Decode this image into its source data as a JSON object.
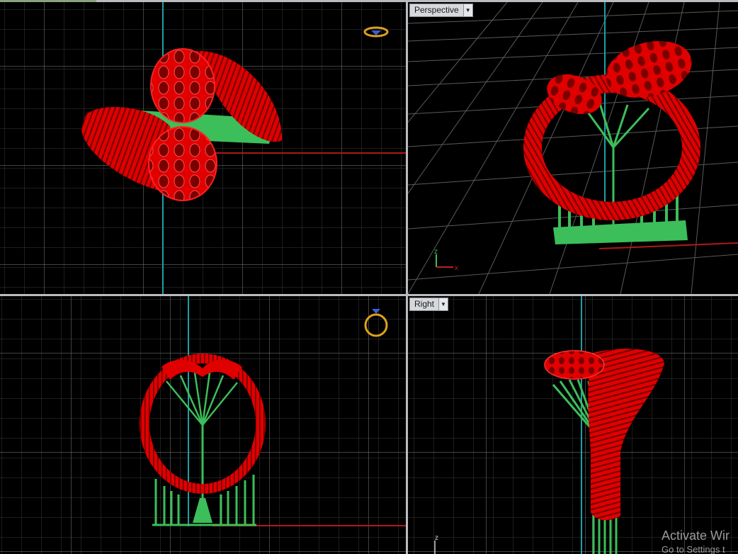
{
  "viewports": {
    "top": {
      "label": ""
    },
    "perspective": {
      "label": "Perspective"
    },
    "front": {
      "label": ""
    },
    "right": {
      "label": "Right"
    }
  },
  "axes": {
    "x": "x",
    "z": "z"
  },
  "watermark": {
    "line1": "Activate Wir",
    "line2": "Go to Settings t"
  },
  "colors": {
    "model": "#e00000",
    "supports": "#3cbe5a",
    "grid_major": "#707070",
    "grid_minor": "#3a3a3a",
    "axis_x": "#b01818",
    "axis_y": "#1ca0a8",
    "background": "#000000"
  }
}
